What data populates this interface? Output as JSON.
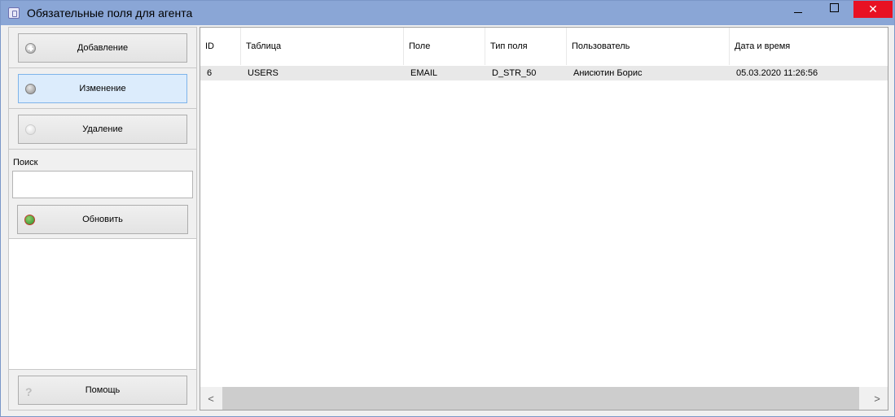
{
  "window": {
    "title": "Обязательные поля для агента",
    "controls": {
      "minimize": "—",
      "close": "✕"
    }
  },
  "sidebar": {
    "add_label": "Добавление",
    "edit_label": "Изменение",
    "delete_label": "Удаление",
    "search_label": "Поиск",
    "search_value": "",
    "refresh_label": "Обновить",
    "help_label": "Помощь",
    "help_icon": "?"
  },
  "grid": {
    "columns": [
      "ID",
      "Таблица",
      "Поле",
      "Тип поля",
      "Пользователь",
      "Дата и время"
    ],
    "rows": [
      [
        "6",
        "USERS",
        "EMAIL",
        "D_STR_50",
        "Анисютин Борис",
        "05.03.2020 11:26:56"
      ]
    ],
    "scroll_left": "<",
    "scroll_right": ">"
  }
}
